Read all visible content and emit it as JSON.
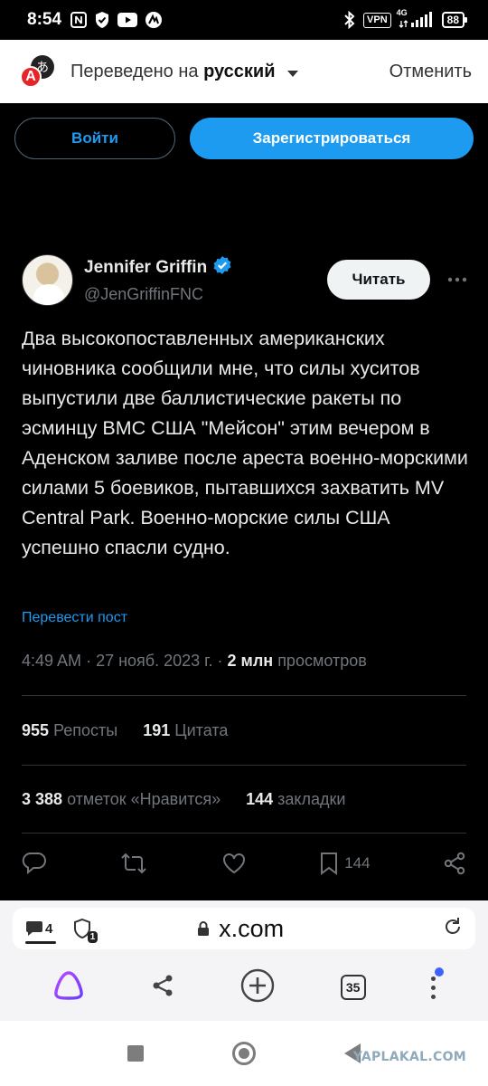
{
  "status_bar": {
    "time": "8:54",
    "vpn": "VPN",
    "network": "4G",
    "battery": "88"
  },
  "translate_bar": {
    "prefix": "Переведено на",
    "language": "русский",
    "cancel": "Отменить",
    "icon_letter": "A",
    "icon_glyph": "あ"
  },
  "auth": {
    "login": "Войти",
    "signup": "Зарегистрироваться"
  },
  "tweet": {
    "author_name": "Jennifer Griffin",
    "handle": "@JenGriffinFNC",
    "follow_label": "Читать",
    "text": "Два высокопоставленных американских чиновника сообщили мне, что силы хуситов выпустили две баллистические ракеты по эсминцу ВМС США \"Мейсон\" этим вечером в Аденском заливе после ареста военно-морскими силами 5 боевиков, пытавшихся захватить MV Central Park. Военно-морские силы США успешно спасли судно.",
    "translate_link": "Перевести пост",
    "time": "4:49 AM",
    "date": "27 нояб. 2023 г.",
    "views_value": "2 млн",
    "views_label": "просмотров",
    "reposts_value": "955",
    "reposts_label": "Репосты",
    "quotes_value": "191",
    "quotes_label": "Цитата",
    "likes_value": "3 388",
    "likes_label": "отметок «Нравится»",
    "bookmarks_value": "144",
    "bookmarks_label": "закладки",
    "bookmark_count": "144"
  },
  "browser": {
    "chat_count": "4",
    "shield_count": "1",
    "url": "x.com",
    "tabs_count": "35"
  },
  "watermark": "YAPLAKAL.COM",
  "colors": {
    "accent": "#1d9bf0",
    "background": "#000000",
    "muted": "#71767b"
  }
}
